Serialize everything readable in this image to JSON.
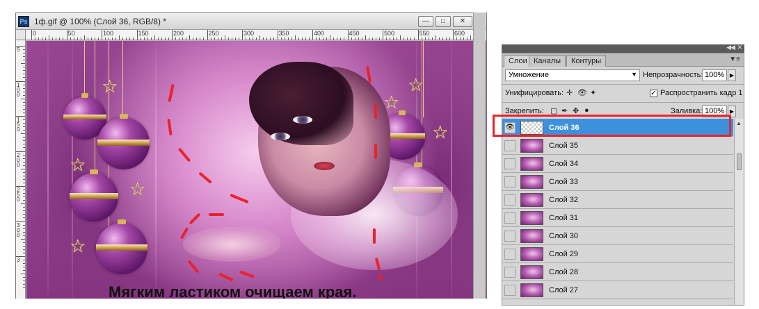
{
  "document": {
    "title": "1ф.gif @ 100% (Слой 36, RGB/8) *",
    "app_icon": "Ps",
    "window_buttons": [
      "minimize",
      "restore",
      "close"
    ],
    "ruler_h_labels": [
      "0",
      "50",
      "100",
      "150",
      "200",
      "250",
      "300",
      "350",
      "400",
      "450",
      "500",
      "550",
      "600"
    ],
    "ruler_v_labels": [
      "5",
      "1 0 0",
      "1 5 0",
      "2 0 0",
      "2 5 0",
      "3 0 0",
      "3"
    ],
    "caption": "Мягким ластиком очищаем края."
  },
  "layers_panel": {
    "tabs": [
      "Слои",
      "Каналы",
      "Контуры"
    ],
    "active_tab": "Слои",
    "blend_mode": "Умножение",
    "opacity_label": "Непрозрачность:",
    "opacity_value": "100%",
    "unify_label": "Унифицировать:",
    "propagate_label": "Распространить кадр 1",
    "propagate_checked": true,
    "lock_label": "Закрепить:",
    "fill_label": "Заливка:",
    "fill_value": "100%",
    "layers": [
      {
        "name": "Слой 36",
        "selected": true,
        "visible": true,
        "thumb": "transparent"
      },
      {
        "name": "Слой 35",
        "selected": false,
        "visible": false,
        "thumb": "image"
      },
      {
        "name": "Слой 34",
        "selected": false,
        "visible": false,
        "thumb": "image"
      },
      {
        "name": "Слой 33",
        "selected": false,
        "visible": false,
        "thumb": "image"
      },
      {
        "name": "Слой 32",
        "selected": false,
        "visible": false,
        "thumb": "image"
      },
      {
        "name": "Слой 31",
        "selected": false,
        "visible": false,
        "thumb": "image"
      },
      {
        "name": "Слой 30",
        "selected": false,
        "visible": false,
        "thumb": "image"
      },
      {
        "name": "Слой 29",
        "selected": false,
        "visible": false,
        "thumb": "image"
      },
      {
        "name": "Слой 28",
        "selected": false,
        "visible": false,
        "thumb": "image"
      },
      {
        "name": "Слой 27",
        "selected": false,
        "visible": false,
        "thumb": "image"
      }
    ],
    "highlight_color": "#e8232c",
    "selected_color": "#3d91dc"
  }
}
